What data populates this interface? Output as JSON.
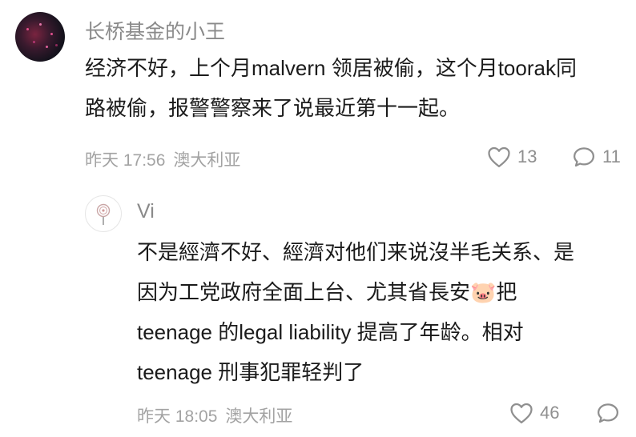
{
  "comment": {
    "username": "长桥基金的小王",
    "text_line1": "经济不好，上个月malvern 领居被偷，这个月toorak同",
    "text_line2": "路被偷，报警警察来了说最近第十一起。",
    "date": "昨天 17:56",
    "location": "澳大利亚",
    "like_count": "13",
    "reply_count": "11"
  },
  "reply": {
    "username": "Vi",
    "text_line1": "不是經濟不好、經濟对他们来说沒半毛关系、是",
    "text_line2": "因为工党政府全面上台、尤其省長安🐷把",
    "text_line3": "teenage 的legal liability 提高了年龄。相对",
    "text_line4": "teenage 刑事犯罪轻判了",
    "date": "昨天 18:05",
    "location": "澳大利亚",
    "like_count": "46"
  },
  "icons": {
    "like": "heart-outline-icon",
    "reply": "speech-bubble-icon"
  },
  "colors": {
    "text": "#1b1b1b",
    "muted": "#8a8a8a",
    "meta": "#a3a3a3",
    "icon": "#8f8f8f"
  }
}
